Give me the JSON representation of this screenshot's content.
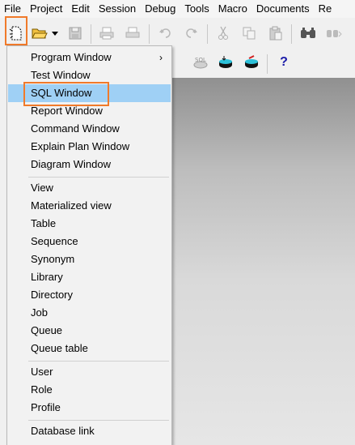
{
  "menubar": [
    "File",
    "Project",
    "Edit",
    "Session",
    "Debug",
    "Tools",
    "Macro",
    "Documents",
    "Re"
  ],
  "toolbar": {
    "icons": [
      "new-icon",
      "open-folder-icon",
      "dropdown-arrow-icon",
      "save-icon",
      "print-icon",
      "print-preview-icon",
      "undo-icon",
      "redo-icon",
      "cut-icon",
      "copy-icon",
      "paste-icon",
      "find-icon",
      "find-next-icon"
    ]
  },
  "toolbar2": {
    "icons": [
      "sql-stop-icon",
      "explain-icon",
      "commit-icon",
      "rollback-icon",
      "help-icon"
    ],
    "help_glyph": "?"
  },
  "menu": {
    "items": [
      {
        "label": "Program Window",
        "submenu": true
      },
      {
        "label": "Test Window"
      },
      {
        "label": "SQL Window",
        "selected": true
      },
      {
        "label": "Report Window"
      },
      {
        "label": "Command Window"
      },
      {
        "label": "Explain Plan Window"
      },
      {
        "label": "Diagram Window"
      },
      {
        "label": "View"
      },
      {
        "label": "Materialized view"
      },
      {
        "label": "Table"
      },
      {
        "label": "Sequence"
      },
      {
        "label": "Synonym"
      },
      {
        "label": "Library"
      },
      {
        "label": "Directory"
      },
      {
        "label": "Job"
      },
      {
        "label": "Queue"
      },
      {
        "label": "Queue table"
      },
      {
        "label": "User"
      },
      {
        "label": "Role"
      },
      {
        "label": "Profile"
      },
      {
        "label": "Database link"
      }
    ],
    "submenu_arrow": "›"
  },
  "colors": {
    "highlight_border": "#f07a2a",
    "selected_bg": "#9fd0f5"
  }
}
